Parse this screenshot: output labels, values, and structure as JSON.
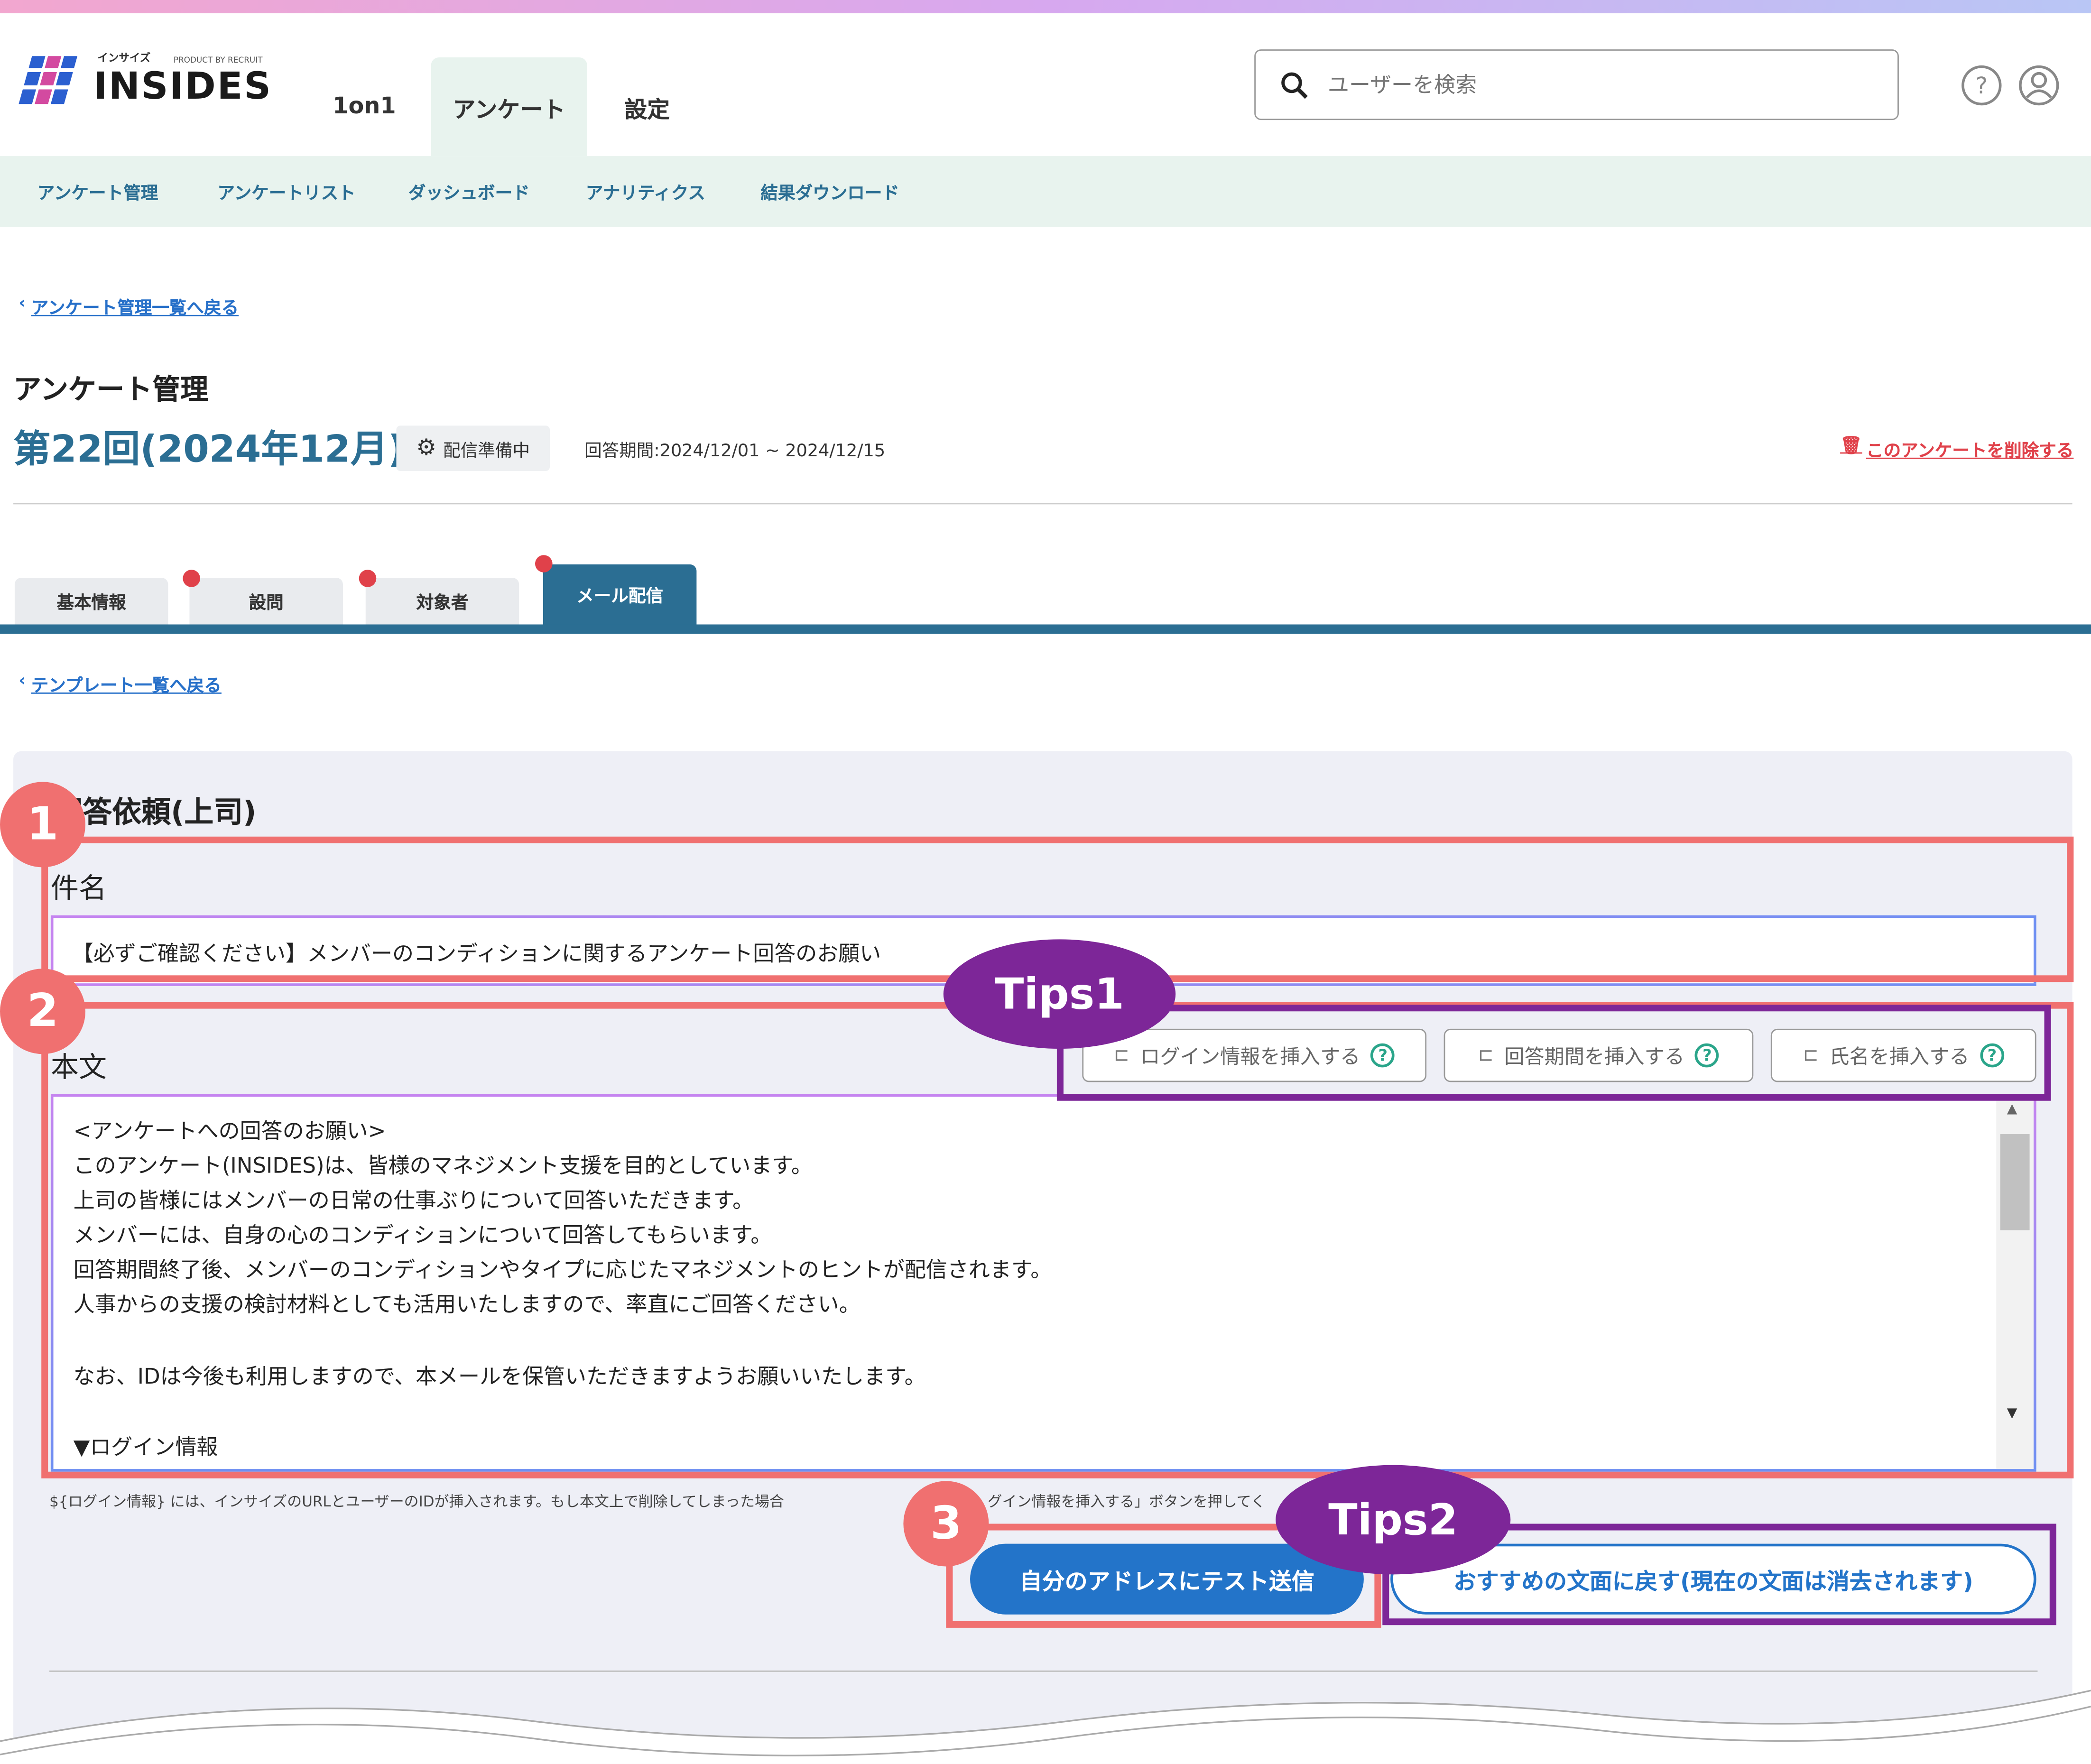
{
  "header": {
    "logo_kana": "インサイズ",
    "logo_sub": "PRODUCT BY RECRUIT",
    "logo_text": "INSIDES",
    "nav": [
      {
        "label": "1on1"
      },
      {
        "label": "アンケート",
        "active": true
      },
      {
        "label": "設定"
      }
    ],
    "search_placeholder": "ユーザーを検索",
    "icons": [
      "search-icon",
      "help-icon",
      "account-icon"
    ]
  },
  "subnav": [
    {
      "label": "アンケート管理"
    },
    {
      "label": "アンケートリスト"
    },
    {
      "label": "ダッシュボード"
    },
    {
      "label": "アナリティクス"
    },
    {
      "label": "結果ダウンロード"
    }
  ],
  "back_link": "アンケート管理一覧へ戻る",
  "page_title": "アンケート管理",
  "survey_name": "第22回(2024年12月)",
  "status": "配信準備中",
  "period": "回答期間:2024/12/01 ~ 2024/12/15",
  "delete_link": "このアンケートを削除する",
  "tabs": [
    {
      "label": "基本情報",
      "alert": false
    },
    {
      "label": "設問",
      "alert": true
    },
    {
      "label": "対象者",
      "alert": true
    },
    {
      "label": "メール配信",
      "alert": true,
      "active": true
    }
  ],
  "template_back_link": "テンプレート一覧へ戻る",
  "form": {
    "title": "回答依頼(上司)",
    "subject_label": "件名",
    "subject_value": "【必ずご確認ください】メンバーのコンディションに関するアンケート回答のお願い",
    "body_label": "本文",
    "insert_buttons": [
      {
        "label": "ログイン情報を挿入する"
      },
      {
        "label": "回答期間を挿入する"
      },
      {
        "label": "氏名を挿入する"
      }
    ],
    "body_lines": [
      "<アンケートへの回答のお願い>",
      "このアンケート(INSIDES)は、皆様のマネジメント支援を目的としています。",
      "上司の皆様にはメンバーの日常の仕事ぶりについて回答いただきます。",
      "メンバーには、自身の心のコンディションについて回答してもらいます。",
      "回答期間終了後、メンバーのコンディションやタイプに応じたマネジメントのヒントが配信されます。",
      "人事からの支援の検討材料としても活用いたしますので、率直にご回答ください。",
      "",
      "なお、IDは今後も利用しますので、本メールを保管いただきますようお願いいたします。",
      "",
      "▼ログイン情報"
    ],
    "hint": "${ログイン情報} には、インサイズのURLとユーザーのIDが挿入されます。もし本文上で削除してしまった場合",
    "hint_tail": "グイン情報を挿入する」ボタンを押してく",
    "test_send_label": "自分のアドレスにテスト送信",
    "reset_label": "おすすめの文面に戻す(現在の文面は消去されます)"
  },
  "annotations": {
    "badges": [
      "1",
      "2",
      "3"
    ],
    "tips": [
      "Tips1",
      "Tips2"
    ],
    "red_color": "#f07070",
    "purple_color": "#7d2698"
  }
}
